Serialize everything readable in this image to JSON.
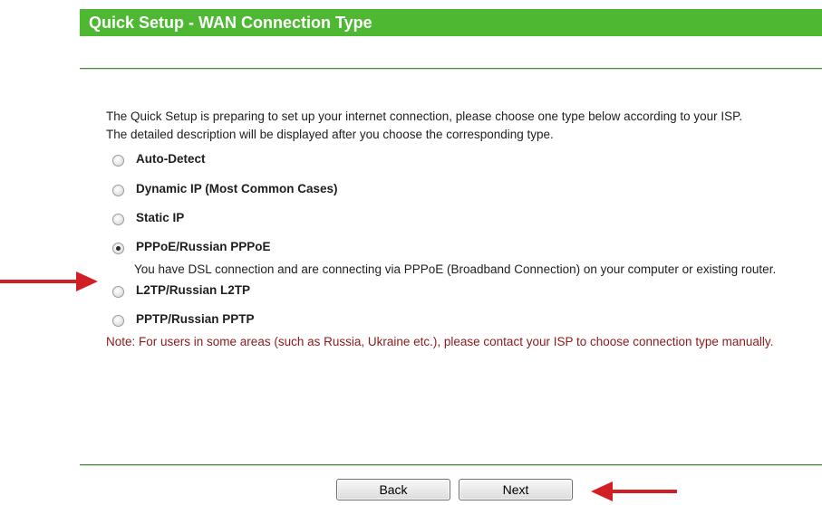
{
  "header": {
    "title": "Quick Setup - WAN Connection Type"
  },
  "intro": {
    "line1": "The Quick Setup is preparing to set up your internet connection, please choose one type below according to your ISP.",
    "line2": "The detailed description will be displayed after you choose the corresponding type."
  },
  "options": [
    {
      "label": "Auto-Detect",
      "checked": false
    },
    {
      "label": "Dynamic IP (Most Common Cases)",
      "checked": false
    },
    {
      "label": "Static IP",
      "checked": false
    },
    {
      "label": "PPPoE/Russian PPPoE",
      "checked": true,
      "description": "You have DSL connection and are connecting via PPPoE (Broadband Connection) on your computer or existing router."
    },
    {
      "label": "L2TP/Russian L2TP",
      "checked": false
    },
    {
      "label": "PPTP/Russian PPTP",
      "checked": false
    }
  ],
  "note": "Note: For users in some areas (such as Russia, Ukraine etc.), please contact your ISP to choose connection type manually.",
  "buttons": {
    "back_label": "Back",
    "next_label": "Next"
  },
  "colors": {
    "header_green": "#4fb833",
    "note_red": "#8b1a1a",
    "annotation_arrow": "#d11f26"
  },
  "icons": {
    "annotation": "red-arrow-icon"
  }
}
